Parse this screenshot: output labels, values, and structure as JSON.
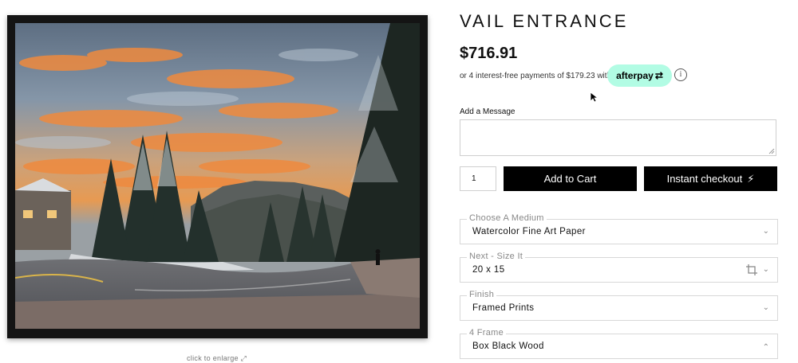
{
  "product": {
    "title": "VAIL ENTRANCE",
    "price": "$716.91",
    "installments_text": "or 4 interest-free payments of $179.23 with",
    "afterpay_label": "afterpay",
    "enlarge_text": "click to enlarge ⤢"
  },
  "message": {
    "label": "Add a Message",
    "value": ""
  },
  "cart": {
    "quantity": "1",
    "add_to_cart_label": "Add to Cart",
    "instant_checkout_label": "Instant checkout"
  },
  "options": [
    {
      "label": "Choose A Medium",
      "value": "Watercolor Fine Art Paper",
      "chevron": "down"
    },
    {
      "label": "Next - Size It",
      "value": "20 x 15",
      "chevron": "down"
    },
    {
      "label": "Finish",
      "value": "Framed Prints",
      "chevron": "down"
    },
    {
      "label": "4 Frame",
      "value": "Box Black Wood",
      "chevron": "up"
    }
  ],
  "icons": {
    "info": "info-icon",
    "bolt": "lightning-icon",
    "crop": "crop-icon",
    "afterpay_loop": "afterpay-loop-icon"
  },
  "colors": {
    "afterpay_bg": "#b2fce4",
    "button_bg": "#000000",
    "frame": "#141414"
  }
}
